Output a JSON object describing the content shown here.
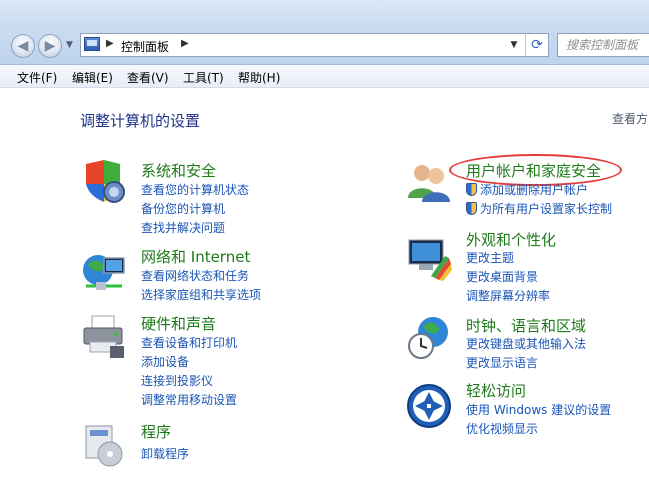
{
  "window": {
    "address_path": "控制面板",
    "search_placeholder": "搜索控制面板",
    "icons": [
      "back-arrow-icon",
      "forward-arrow-icon",
      "control-panel-icon",
      "refresh-icon"
    ]
  },
  "menu": [
    "文件(F)",
    "编辑(E)",
    "查看(V)",
    "工具(T)",
    "帮助(H)"
  ],
  "page": {
    "title": "调整计算机的设置",
    "view_by": "查看方"
  },
  "categories": [
    {
      "title": "系统和安全",
      "icon": "system-security-icon",
      "links": [
        "查看您的计算机状态",
        "备份您的计算机",
        "查找并解决问题"
      ]
    },
    {
      "title": "网络和 Internet",
      "icon": "network-globe-icon",
      "links": [
        "查看网络状态和任务",
        "选择家庭组和共享选项"
      ]
    },
    {
      "title": "硬件和声音",
      "icon": "printer-hardware-icon",
      "links": [
        "查看设备和打印机",
        "添加设备",
        "连接到投影仪",
        "调整常用移动设置"
      ]
    },
    {
      "title": "程序",
      "icon": "programs-icon",
      "links": [
        "卸载程序"
      ]
    },
    {
      "title": "用户帐户和家庭安全",
      "icon": "users-icon",
      "links": [
        "添加或删除用户帐户",
        "为所有用户设置家长控制"
      ]
    },
    {
      "title": "外观和个性化",
      "icon": "appearance-icon",
      "links": [
        "更改主题",
        "更改桌面背景",
        "调整屏幕分辨率"
      ]
    },
    {
      "title": "时钟、语言和区域",
      "icon": "clock-language-icon",
      "links": [
        "更改键盘或其他输入法",
        "更改显示语言"
      ]
    },
    {
      "title": "轻松访问",
      "icon": "ease-of-access-icon",
      "links": [
        "使用 Windows 建议的设置",
        "优化视频显示"
      ]
    }
  ],
  "colors": {
    "category_title": "#1f7a1a",
    "link": "#1a55b7",
    "heading": "#1e3287",
    "annotation": "#e53d3d"
  }
}
